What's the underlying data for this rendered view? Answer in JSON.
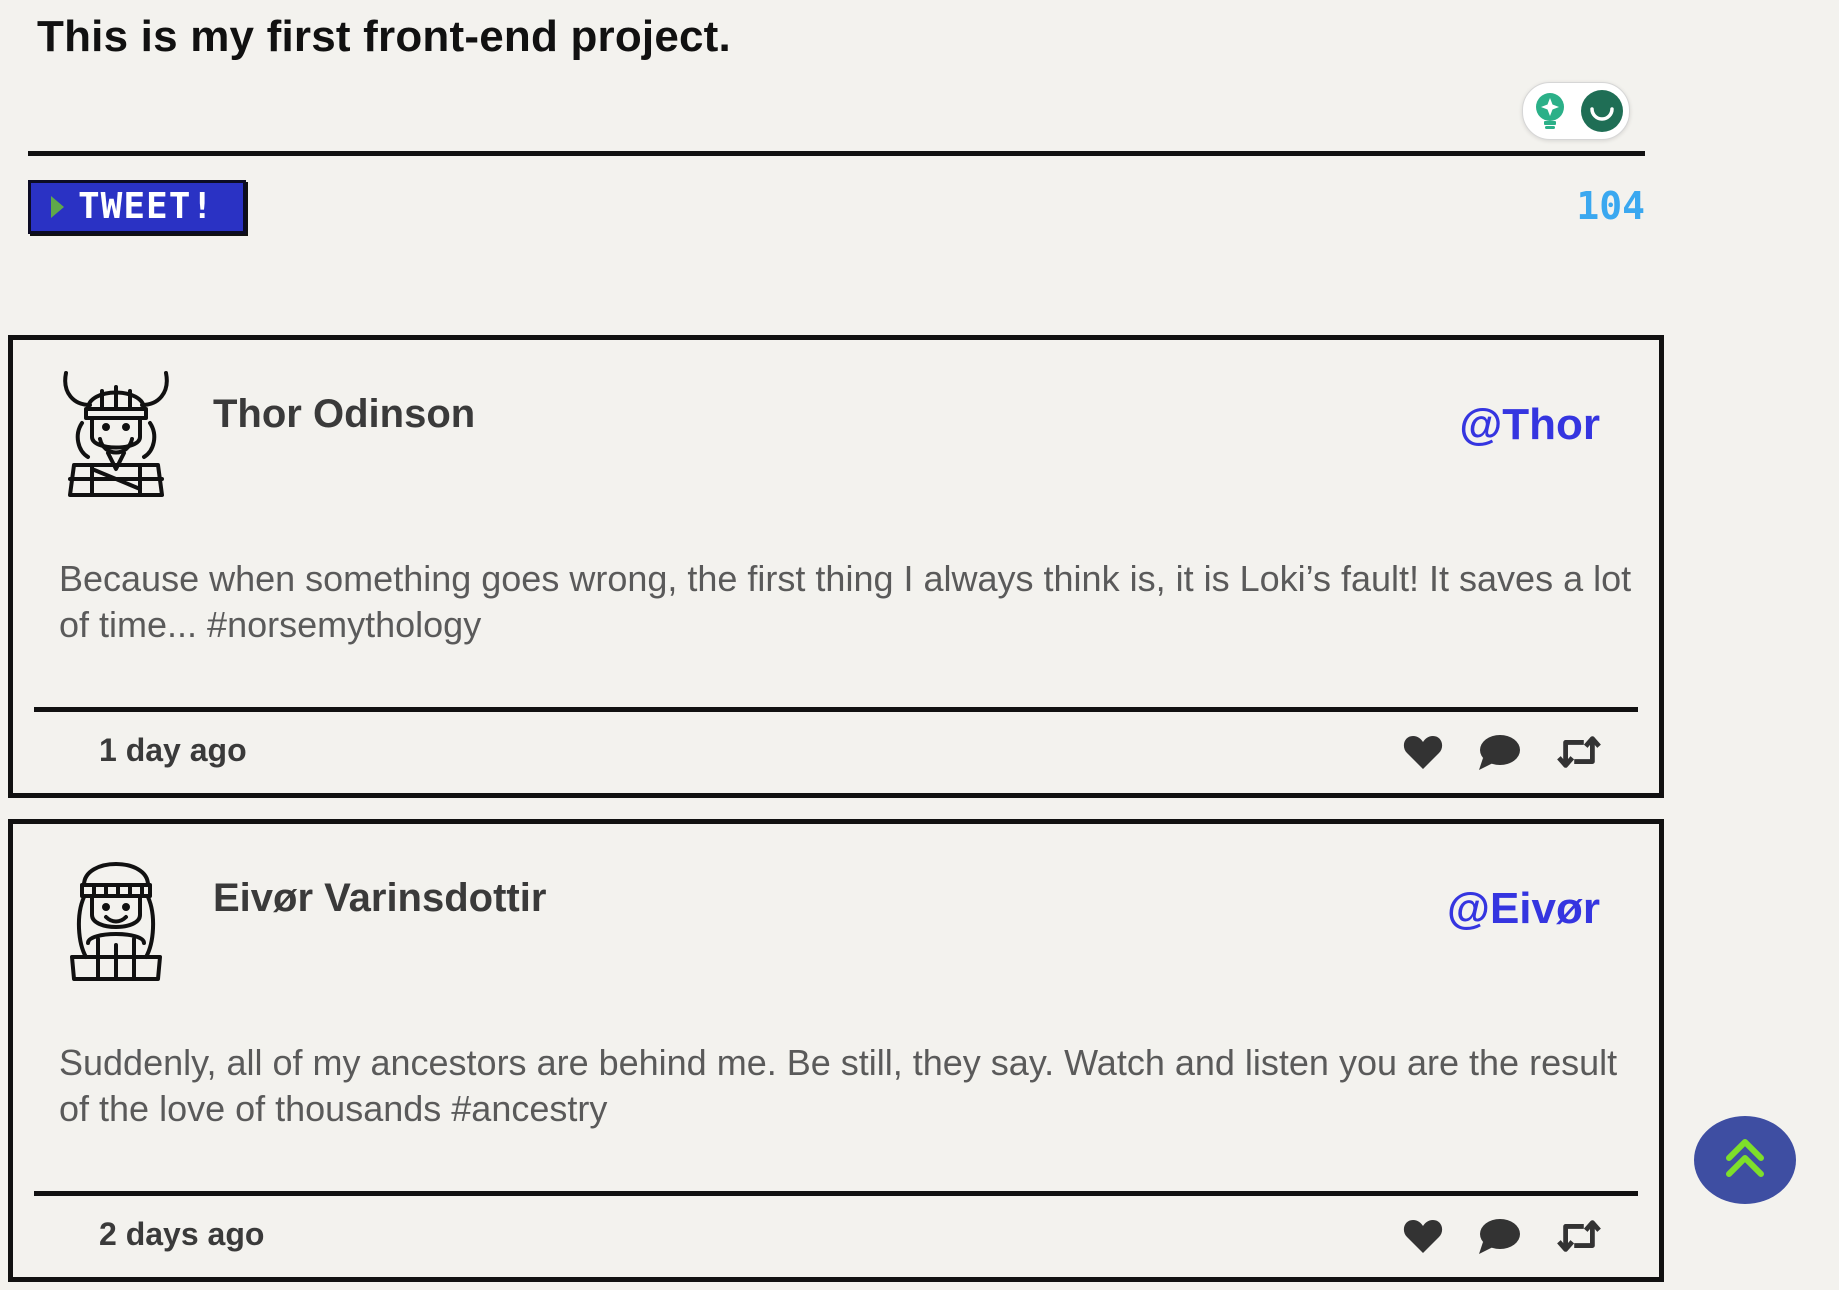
{
  "composer": {
    "text": "This is my first front-end project.",
    "tweet_button_label": "TWEET!",
    "char_count": "104"
  },
  "tweets": [
    {
      "author": "Thor Odinson",
      "handle": "@Thor",
      "text": "Because when something goes wrong, the first thing I always think is, it is Loki’s fault! It saves a lot of time... #norsemythology",
      "time": "1 day ago",
      "avatar_icon": "viking-warrior-icon"
    },
    {
      "author": "Eivør Varinsdottir",
      "handle": "@Eivør",
      "text": "Suddenly, all of my ancestors are behind me. Be still, they say. Watch and listen you are the result of the love of thousands #ancestry",
      "time": "2 days ago",
      "avatar_icon": "viking-woman-icon"
    }
  ],
  "colors": {
    "background": "#f3f2ee",
    "tweet_button": "#2a32c4",
    "char_count": "#3aa8f0",
    "handle": "#3535e0",
    "scroll_top_button": "#3e4ea2",
    "scroll_top_arrow": "#7ee02a"
  }
}
